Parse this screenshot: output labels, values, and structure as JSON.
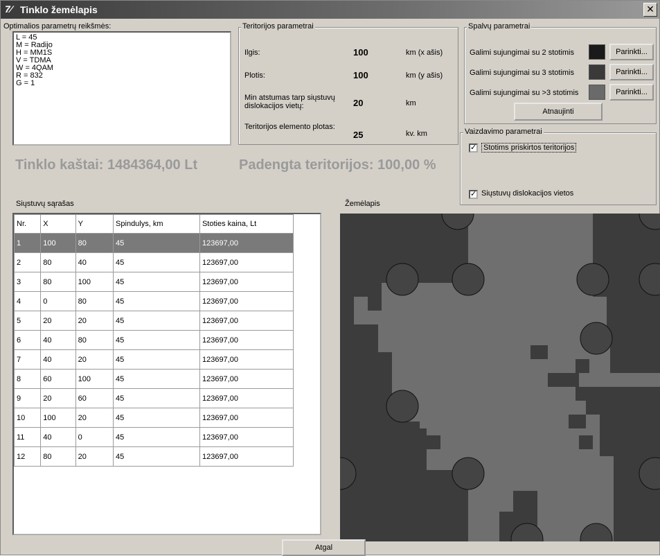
{
  "window": {
    "title": "Tinklo žemėlapis",
    "close_glyph": "✕",
    "app_icon": "7⁄"
  },
  "optimal": {
    "title": "Optimalios parametrų reikšmės:",
    "lines": [
      "L = 45",
      "M = Radijo",
      "H = MM1S",
      "V = TDMA",
      "W = 4QAM",
      "R = 832",
      "G = 1"
    ]
  },
  "territory": {
    "title": "Teritorijos parametrai",
    "rows": [
      {
        "label": "Ilgis:",
        "value": "100",
        "unit": "km (x ašis)"
      },
      {
        "label": "Plotis:",
        "value": "100",
        "unit": "km (y ašis)"
      },
      {
        "label": "Min atstumas tarp siųstuvų dislokacijos vietų:",
        "value": "20",
        "unit": "km"
      },
      {
        "label": "Teritorijos elemento plotas:",
        "value": "25",
        "unit": "kv. km"
      }
    ]
  },
  "colors": {
    "title": "Spalvų parametrai",
    "rows": [
      {
        "label": "Galimi sujungimai su 2 stotimis",
        "swatch": "#1a1a1a",
        "button": "Parinkti..."
      },
      {
        "label": "Galimi sujungimai su 3 stotimis",
        "swatch": "#3a3a3a",
        "button": "Parinkti..."
      },
      {
        "label": "Galimi sujungimai su >3 stotimis",
        "swatch": "#6a6a6a",
        "button": "Parinkti..."
      }
    ],
    "refresh": "Atnaujinti"
  },
  "display": {
    "title": "Vaizdavimo parametrai",
    "options": [
      {
        "label": "Stotims priskirtos teritorijos",
        "checked": true
      },
      {
        "label": "Siųstuvų dislokacijos vietos",
        "checked": true
      }
    ]
  },
  "summary": {
    "cost": "Tinklo kaštai: 1484364,00 Lt",
    "coverage": "Padengta teritorijos: 100,00 %"
  },
  "list": {
    "title": "Siųstuvų sąrašas",
    "columns": [
      "Nr.",
      "X",
      "Y",
      "Spindulys, km",
      "Stoties kaina, Lt"
    ],
    "rows": [
      [
        "1",
        "100",
        "80",
        "45",
        "123697,00"
      ],
      [
        "2",
        "80",
        "40",
        "45",
        "123697,00"
      ],
      [
        "3",
        "80",
        "100",
        "45",
        "123697,00"
      ],
      [
        "4",
        "0",
        "80",
        "45",
        "123697,00"
      ],
      [
        "5",
        "20",
        "20",
        "45",
        "123697,00"
      ],
      [
        "6",
        "40",
        "80",
        "45",
        "123697,00"
      ],
      [
        "7",
        "40",
        "20",
        "45",
        "123697,00"
      ],
      [
        "8",
        "60",
        "100",
        "45",
        "123697,00"
      ],
      [
        "9",
        "20",
        "60",
        "45",
        "123697,00"
      ],
      [
        "10",
        "100",
        "20",
        "45",
        "123697,00"
      ],
      [
        "11",
        "40",
        "0",
        "45",
        "123697,00"
      ],
      [
        "12",
        "80",
        "20",
        "45",
        "123697,00"
      ]
    ],
    "selected_row": 1
  },
  "map": {
    "title": "Žemėlapis",
    "dark_color": "#3c3c3c",
    "mid_color": "#6f6f6f",
    "circle_color": "#444444"
  },
  "footer": {
    "back": "Atgal"
  }
}
